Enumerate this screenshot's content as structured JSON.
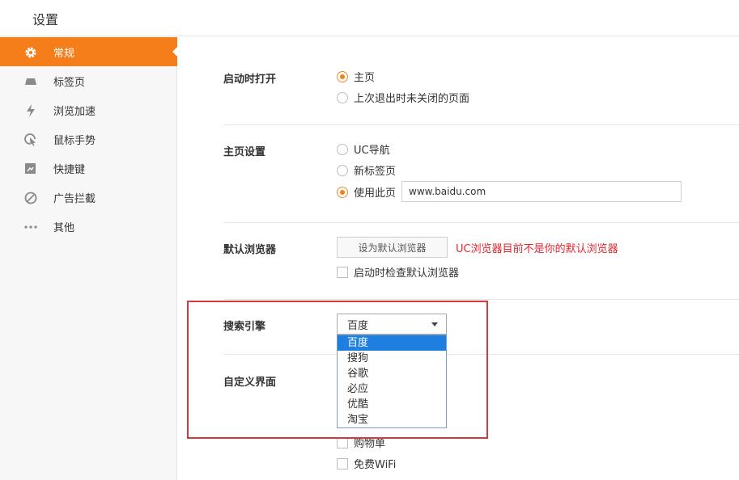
{
  "header": {
    "title": "设置"
  },
  "sidebar": {
    "items": [
      {
        "label": "常规",
        "icon": "gear-icon",
        "active": true
      },
      {
        "label": "标签页",
        "icon": "tab-icon"
      },
      {
        "label": "浏览加速",
        "icon": "lightning-icon"
      },
      {
        "label": "鼠标手势",
        "icon": "mouse-gesture-icon"
      },
      {
        "label": "快捷键",
        "icon": "shortcut-icon"
      },
      {
        "label": "广告拦截",
        "icon": "block-icon"
      },
      {
        "label": "其他",
        "icon": "more-icon"
      }
    ]
  },
  "startup": {
    "label": "启动时打开",
    "options": [
      "主页",
      "上次退出时未关闭的页面"
    ],
    "selected": "主页"
  },
  "homepage": {
    "label": "主页设置",
    "options": [
      "UC导航",
      "新标签页",
      "使用此页"
    ],
    "selected": "使用此页",
    "url": "www.baidu.com"
  },
  "default_browser": {
    "label": "默认浏览器",
    "button": "设为默认浏览器",
    "warning": "UC浏览器目前不是你的默认浏览器",
    "check_label": "启动时检查默认浏览器"
  },
  "search_engine": {
    "label": "搜索引擎",
    "selected": "百度",
    "options": [
      "百度",
      "搜狗",
      "谷歌",
      "必应",
      "优酷",
      "淘宝"
    ]
  },
  "custom_ui": {
    "label": "自定义界面",
    "items": [
      "购物单",
      "免费WiFi"
    ]
  },
  "colors": {
    "accent": "#f57e1a",
    "warning": "#e0262c",
    "highlight_box": "#d9373a",
    "dropdown_selected": "#1e7fe0"
  }
}
